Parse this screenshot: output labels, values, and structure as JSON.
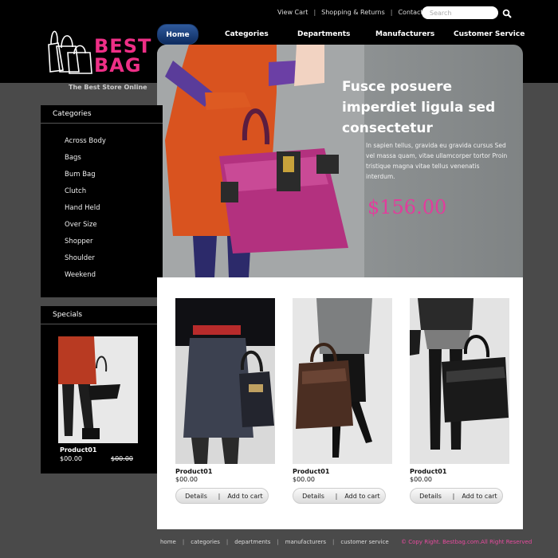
{
  "header": {
    "util_links": [
      "View Cart",
      "Shopping & Returns",
      "Contact Us"
    ],
    "search_placeholder": "Search"
  },
  "logo": {
    "line1": "BEST",
    "line2": "BAG",
    "tagline": "The Best Store Online",
    "brand_color": "#ee2f86"
  },
  "nav": {
    "items": [
      "Home",
      "Categories",
      "Departments",
      "Manufacturers",
      "Customer Service"
    ],
    "active_color": "#1f4a8c"
  },
  "hero": {
    "title": "Fusce posuere imperdiet ligula sed consectetur",
    "body": "In sapien tellus, gravida eu gravida cursus Sed vel massa quam, vitae ullamcorper tortor Proin tristique magna vitae tellus venenatis interdum.",
    "price": "$156.00"
  },
  "categories": {
    "title": "Categories",
    "items": [
      "Across Body",
      "Bags",
      "Bum Bag",
      "Clutch",
      "Hand Held",
      "Over Size",
      "Shopper",
      "Shoulder",
      "Weekend"
    ]
  },
  "specials": {
    "title": "Specials",
    "product_name": "Product01",
    "price": "$00.00",
    "old_price": "$00.00"
  },
  "products": [
    {
      "name": "Product01",
      "price": "$00.00",
      "details_label": "Details",
      "cart_label": "Add to cart"
    },
    {
      "name": "Product01",
      "price": "$00.00",
      "details_label": "Details",
      "cart_label": "Add to cart"
    },
    {
      "name": "Product01",
      "price": "$00.00",
      "details_label": "Details",
      "cart_label": "Add to cart"
    }
  ],
  "footer": {
    "links": [
      "home",
      "categories",
      "departments",
      "manufacturers",
      "customer service"
    ],
    "copyright": "© Copy Right. Bestbag.com.All Right Reserved"
  }
}
